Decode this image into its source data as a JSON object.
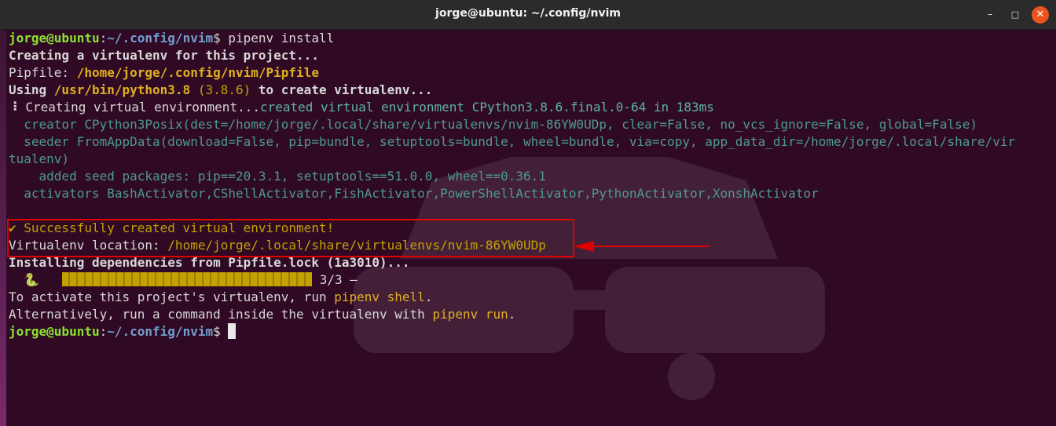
{
  "window": {
    "title": "jorge@ubuntu: ~/.config/nvim",
    "minimize_label": "–",
    "maximize_label": "□",
    "close_label": "✕"
  },
  "prompt": {
    "user_host": "jorge@ubuntu",
    "colon": ":",
    "path": "~/.config/nvim",
    "dollar": "$ "
  },
  "lines": {
    "cmd": "pipenv install",
    "creating": "Creating a virtualenv for this project...",
    "pipfile_label": "Pipfile: ",
    "pipfile_path": "/home/jorge/.config/nvim/Pipfile",
    "using_label": "Using ",
    "using_python": "/usr/bin/python3.8",
    "using_version": " (3.8.6)",
    "using_tail": " to create virtualenv...",
    "spinner": "⠸",
    "creating_env": " Creating virtual environment...",
    "created_env": "created virtual environment CPython3.8.6.final.0-64 in 183ms",
    "creator": "  creator CPython3Posix(dest=/home/jorge/.local/share/virtualenvs/nvim-86YW0UDp, clear=False, no_vcs_ignore=False, global=False)",
    "seeder_1": "  seeder FromAppData(download=False, pip=bundle, setuptools=bundle, wheel=bundle, via=copy, app_data_dir=/home/jorge/.local/share/vir",
    "seeder_2": "tualenv)",
    "added_seed": "    added seed packages: pip==20.3.1, setuptools==51.0.0, wheel==0.36.1",
    "activators": "  activators BashActivator,CShellActivator,FishActivator,PowerShellActivator,PythonActivator,XonshActivator",
    "success": "✔ Successfully created virtual environment!",
    "venv_label": "Virtualenv location: ",
    "venv_path": "/home/jorge/.local/share/virtualenvs/nvim-86YW0UDp",
    "installing": "Installing dependencies from Pipfile.lock (1a3010)...",
    "snake": "  🐍   ",
    "progress_count": " 3/3 —",
    "activate_1": "To activate this project's virtualenv, run ",
    "activate_cmd": "pipenv shell",
    "activate_2": ".",
    "alt_1": "Alternatively, run a command inside the virtualenv with ",
    "alt_cmd": "pipenv run",
    "alt_2": "."
  },
  "progress": {
    "completed": 3,
    "total": 3
  },
  "colors": {
    "background": "#300a24",
    "prompt_user": "#8ae234",
    "prompt_path": "#729fcf",
    "highlight": "#e00000",
    "close_button": "#e95420"
  }
}
